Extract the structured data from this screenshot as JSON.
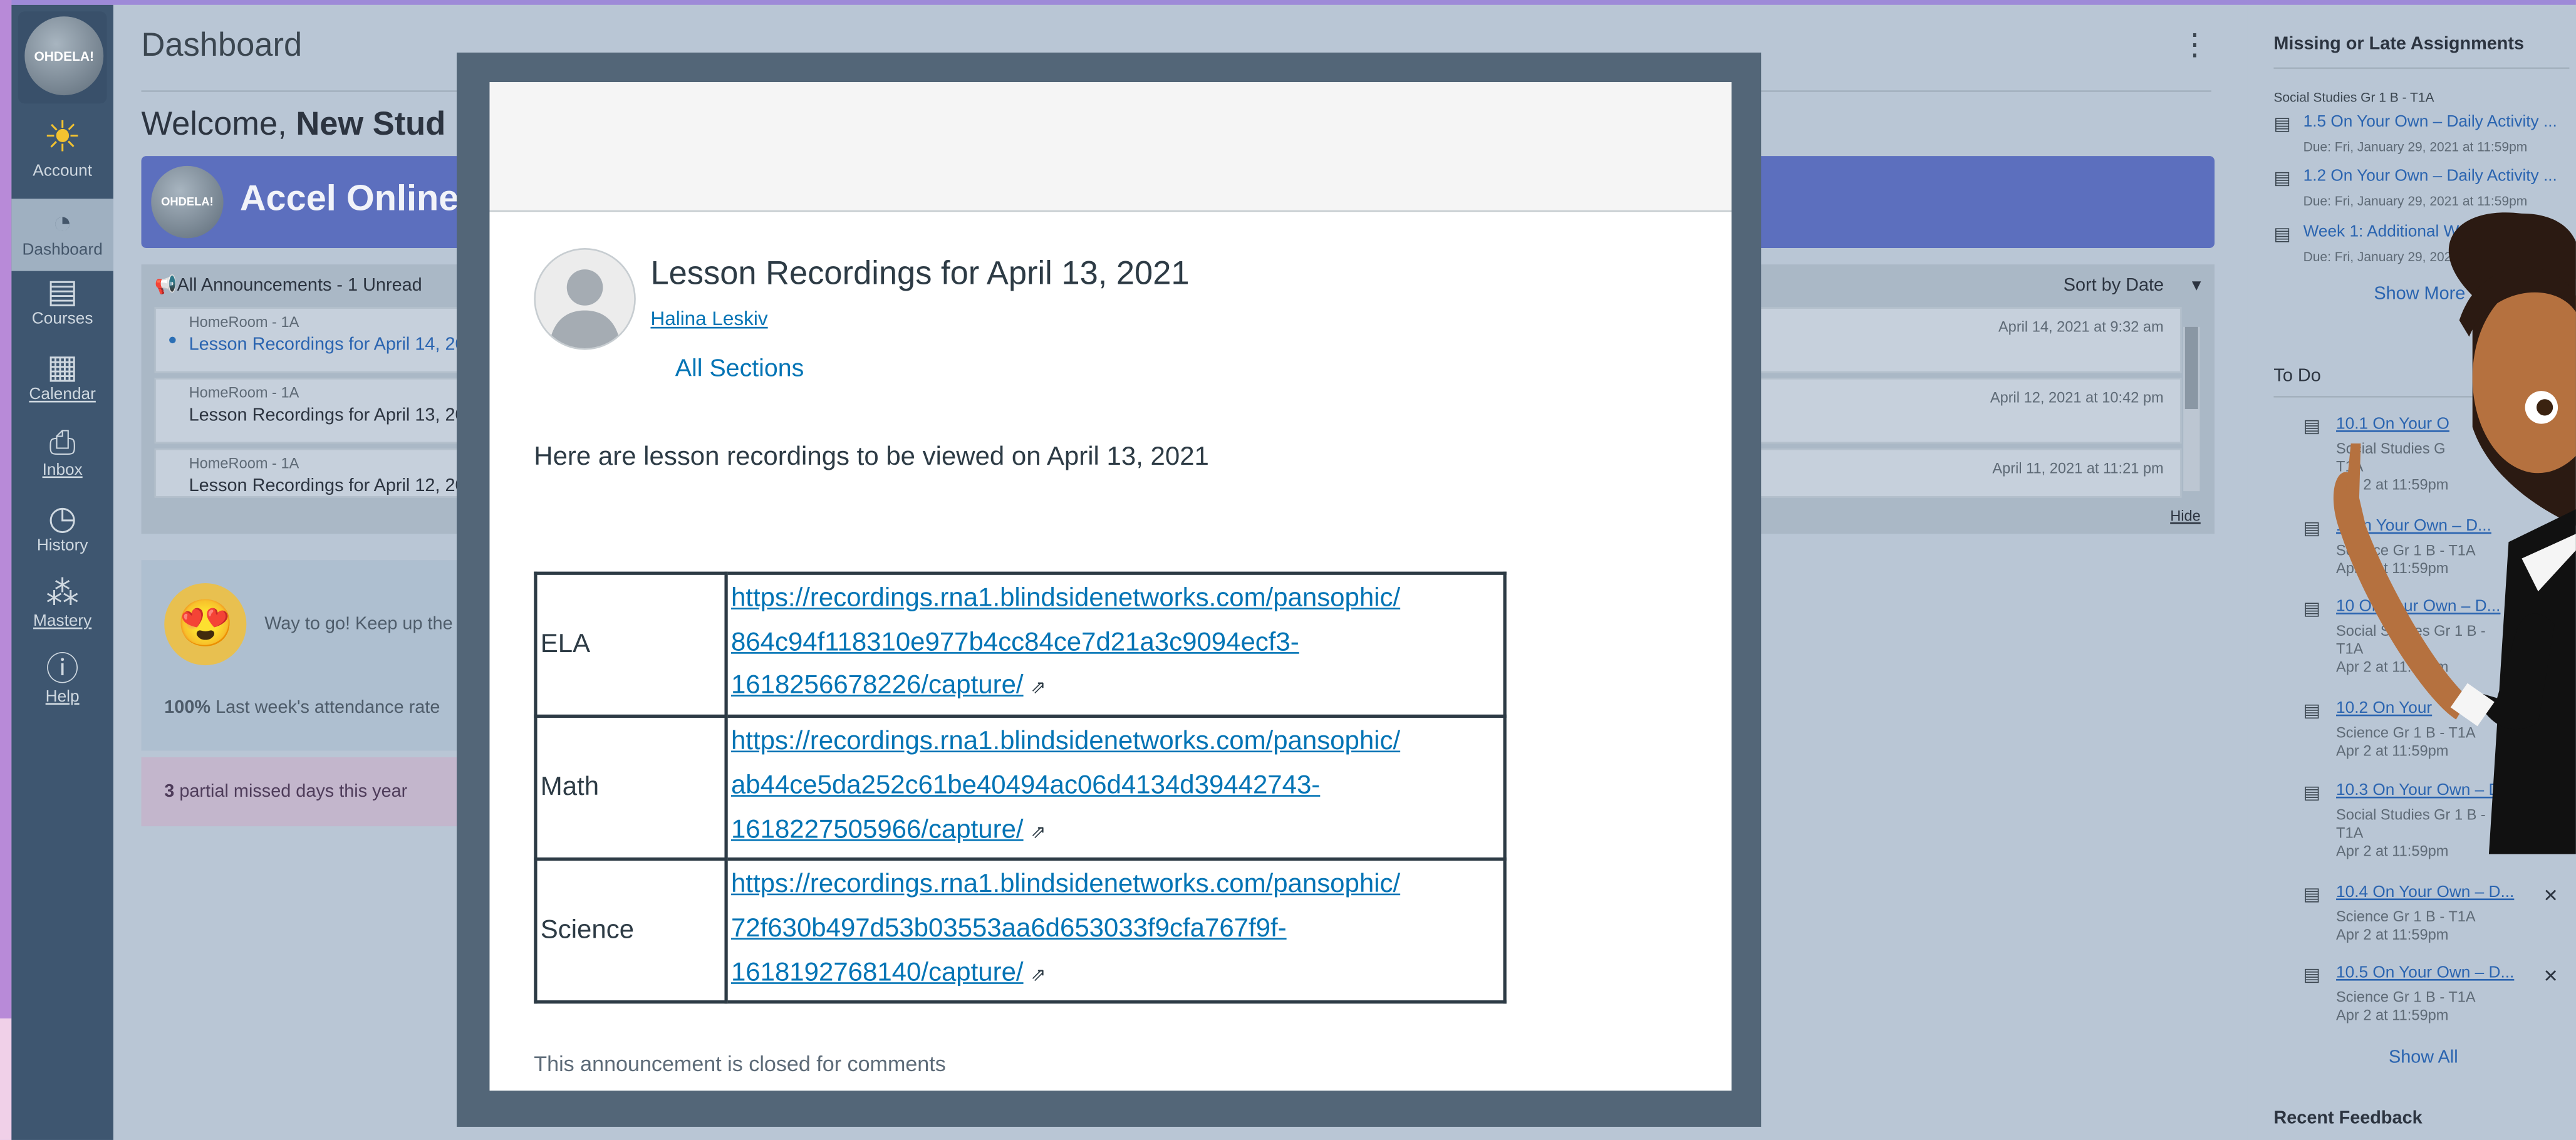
{
  "nav": {
    "logo_text": "OHDELA!",
    "items": [
      {
        "label": "Account",
        "icon": "sun-avatar-icon"
      },
      {
        "label": "Dashboard",
        "icon": "dashboard-icon"
      },
      {
        "label": "Courses",
        "icon": "book-icon"
      },
      {
        "label": "Calendar",
        "icon": "calendar-icon"
      },
      {
        "label": "Inbox",
        "icon": "inbox-icon"
      },
      {
        "label": "History",
        "icon": "clock-icon"
      },
      {
        "label": "Mastery",
        "icon": "mastery-icon"
      },
      {
        "label": "Help",
        "icon": "help-icon"
      }
    ]
  },
  "main": {
    "title": "Dashboard",
    "welcome_prefix": "Welcome,",
    "welcome_name": "New Stud",
    "banner_logo": "OHDELA!",
    "banner_title": "Accel Online",
    "announcements": {
      "header": "All Announcements - 1 Unread",
      "sort": "Sort by Date",
      "hide": "Hide",
      "rows": [
        {
          "context": "HomeRoom - 1A",
          "title": "Lesson Recordings for April 14, 202",
          "date": "April 14, 2021 at 9:32 am"
        },
        {
          "context": "HomeRoom - 1A",
          "title": "Lesson Recordings for April 13, 202",
          "date": "April 12, 2021 at 10:42 pm"
        },
        {
          "context": "HomeRoom - 1A",
          "title": "Lesson Recordings for April 12, 202",
          "date": "April 11, 2021 at 11:21 pm"
        }
      ]
    },
    "praise": "Way to go! Keep up the",
    "attendance_value": "100%",
    "attendance_text": "Last week's attendance rate",
    "missed_value": "3",
    "missed_text": "partial missed days this year"
  },
  "right": {
    "missing_title": "Missing or Late Assignments",
    "missing_context": "Social Studies Gr 1 B - T1A",
    "missing": [
      {
        "title": "1.5 On Your Own – Daily Activity ...",
        "due": "Due: Fri, January 29, 2021 at 11:59pm"
      },
      {
        "title": "1.2 On Your Own – Daily Activity ...",
        "due": "Due: Fri, January 29, 2021 at 11:59pm"
      },
      {
        "title": "Week 1: Additional Weekly C",
        "due": "Due: Fri, January 29, 2021 at 11"
      }
    ],
    "show_more": "Show More",
    "todo_title": "To Do",
    "todo": [
      {
        "title": "10.1 On Your O",
        "course": "Social Studies G",
        "line2": "T1A",
        "date": "Apr 2 at 11:59pm"
      },
      {
        "title": "1 On Your Own – D...",
        "course": "Science Gr 1 B - T1A",
        "line2": "",
        "date": "Apr 2 at 11:59pm"
      },
      {
        "title": "10 On Your Own – D...",
        "course": "Social Studies Gr 1 B -",
        "line2": "T1A",
        "date": "Apr 2 at 11:59pm"
      },
      {
        "title": "10.2 On Your",
        "course": "Science Gr 1 B - T1A",
        "line2": "",
        "date": "Apr 2 at 11:59pm"
      },
      {
        "title": "10.3 On Your Own – D...",
        "course": "Social Studies Gr 1 B -",
        "line2": "T1A",
        "date": "Apr 2 at 11:59pm"
      },
      {
        "title": "10.4 On Your Own – D...",
        "course": "Science Gr 1 B - T1A",
        "line2": "",
        "date": "Apr 2 at 11:59pm"
      },
      {
        "title": "10.5 On Your Own – D...",
        "course": "Science Gr 1 B - T1A",
        "line2": "",
        "date": "Apr 2 at 11:59pm"
      }
    ],
    "show_all": "Show All",
    "recent_feedback": "Recent Feedback"
  },
  "modal": {
    "title": "Lesson Recordings for April 13, 2021",
    "author": "Halina Leskiv",
    "sections": "All Sections",
    "intro": "Here are lesson recordings to be viewed on April 13, 2021",
    "rows": [
      {
        "subject": "ELA",
        "url_l1": "https://recordings.rna1.blindsidenetworks.com/pansophic/",
        "url_l2": "864c94f118310e977b4cc84ce7d21a3c9094ecf3-",
        "url_l3": "1618256678226/capture/"
      },
      {
        "subject": "Math",
        "url_l1": "https://recordings.rna1.blindsidenetworks.com/pansophic/",
        "url_l2": "ab44ce5da252c61be40494ac06d4134d39442743-",
        "url_l3": "1618227505966/capture/"
      },
      {
        "subject": "Science",
        "url_l1": "https://recordings.rna1.blindsidenetworks.com/pansophic/",
        "url_l2": "72f630b497d53b03553aa6d653033f9cfa767f9f-",
        "url_l3": "1618192768140/capture/"
      }
    ],
    "closed": "This announcement is closed for comments"
  }
}
